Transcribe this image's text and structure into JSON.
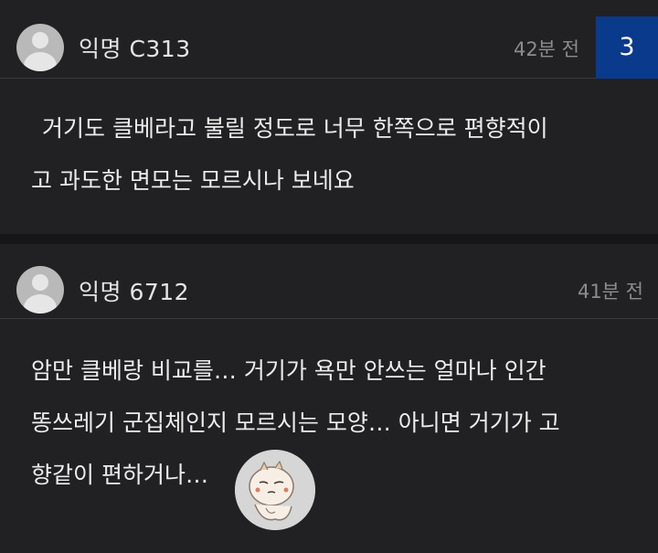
{
  "comments": [
    {
      "author": "익명 C313",
      "time": "42분 전",
      "badge": "3",
      "lines": [
        "거기도 클베라고 불릴 정도로 너무 한쪽으로 편향적이",
        "고 과도한 면모는 모르시나 보네요"
      ]
    },
    {
      "author": "익명 6712",
      "time": "41분 전",
      "lines": [
        "암만 클베랑 비교를… 거기가 욕만 안쓰는 얼마나 인간",
        "똥쓰레기 군집체인지 모르시는 모양… 아니면 거기가 고",
        "향같이 편하거나…"
      ],
      "sticker": "emoticon-sticker-icon"
    }
  ],
  "colors": {
    "background": "#161618",
    "card": "#212123",
    "badge": "#0a3a8c",
    "text": "#ececec",
    "muted": "#8c8c8c"
  }
}
